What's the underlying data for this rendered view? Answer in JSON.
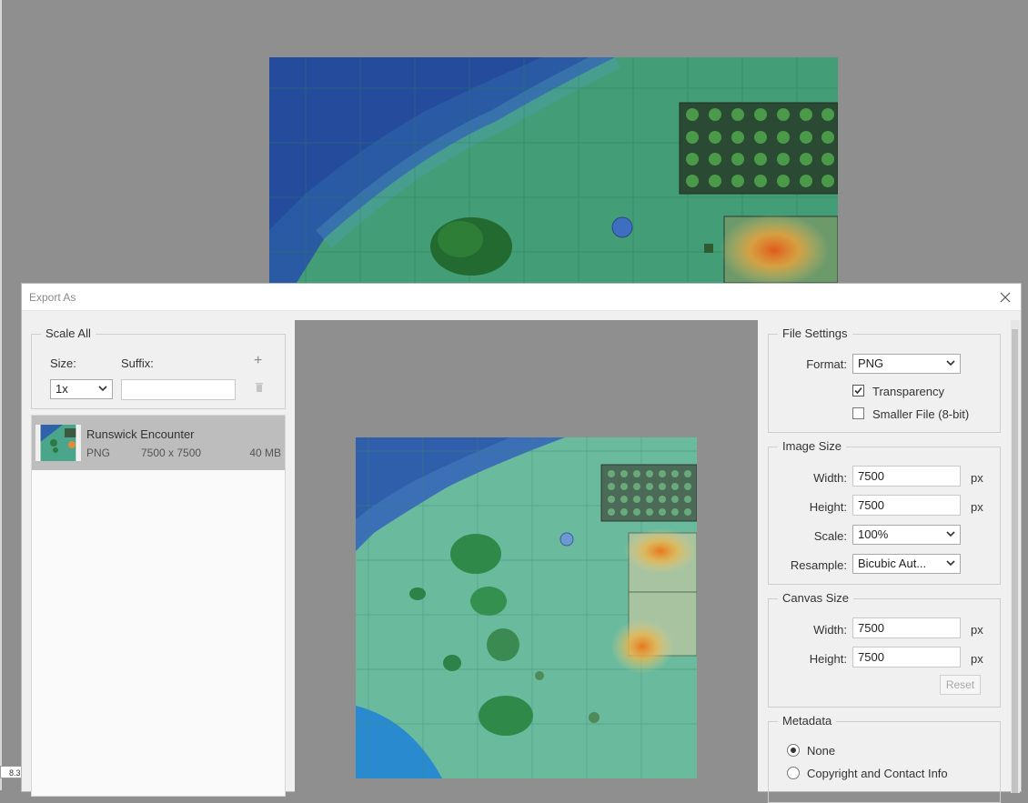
{
  "status": {
    "zoom": "8.3"
  },
  "dialog": {
    "title": "Export As"
  },
  "scale_all": {
    "legend": "Scale All",
    "size_label": "Size:",
    "suffix_label": "Suffix:",
    "size_value": "1x",
    "suffix_value": "",
    "add_icon": "+",
    "delete_icon": "trash-icon"
  },
  "asset": {
    "name": "Runswick Encounter",
    "format": "PNG",
    "dimensions": "7500 x 7500",
    "filesize": "40 MB"
  },
  "file_settings": {
    "legend": "File Settings",
    "format_label": "Format:",
    "format_value": "PNG",
    "transparency_label": "Transparency",
    "transparency_checked": true,
    "smaller_file_label": "Smaller File (8-bit)",
    "smaller_file_checked": false
  },
  "image_size": {
    "legend": "Image Size",
    "width_label": "Width:",
    "width_value": "7500",
    "height_label": "Height:",
    "height_value": "7500",
    "unit": "px",
    "scale_label": "Scale:",
    "scale_value": "100%",
    "resample_label": "Resample:",
    "resample_value": "Bicubic Aut..."
  },
  "canvas_size": {
    "legend": "Canvas Size",
    "width_label": "Width:",
    "width_value": "7500",
    "height_label": "Height:",
    "height_value": "7500",
    "unit": "px",
    "reset_label": "Reset"
  },
  "metadata": {
    "legend": "Metadata",
    "option_none": "None",
    "option_copyright": "Copyright and Contact Info",
    "selected": "None"
  },
  "colors": {
    "map_green": "#3f9a72",
    "water_blue": "#2b62a8",
    "fire_orange": "#e8782a"
  }
}
